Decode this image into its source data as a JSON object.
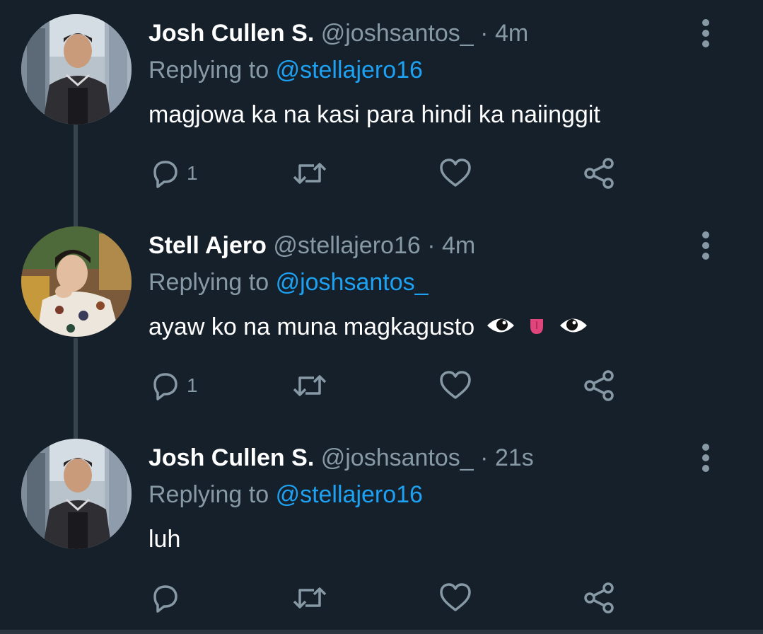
{
  "tweets": [
    {
      "name": "Josh Cullen S.",
      "handle": "@joshsantos_",
      "separator": "·",
      "time": "4m",
      "reply_prefix": "Replying to",
      "reply_to": "@stellajero16",
      "text": "magjowa ka na kasi para hindi ka naiinggit",
      "reply_count": "1",
      "avatar": "josh-avatar"
    },
    {
      "name": "Stell Ajero",
      "handle": "@stellajero16",
      "separator": "·",
      "time": "4m",
      "reply_prefix": "Replying to",
      "reply_to": "@joshsantos_",
      "text": "ayaw ko na muna magkagusto",
      "emojis": [
        "eye",
        "tongue",
        "eye"
      ],
      "reply_count": "1",
      "avatar": "stell-avatar"
    },
    {
      "name": "Josh Cullen S.",
      "handle": "@joshsantos_",
      "separator": "·",
      "time": "21s",
      "reply_prefix": "Replying to",
      "reply_to": "@stellajero16",
      "text": "luh",
      "reply_count": "",
      "avatar": "josh-avatar"
    }
  ],
  "icons": {
    "reply": "reply-icon",
    "retweet": "retweet-icon",
    "like": "heart-icon",
    "share": "share-icon",
    "more": "more-vertical-icon"
  },
  "colors": {
    "background": "#15202b",
    "text": "#ffffff",
    "muted": "#8899a6",
    "link": "#1da1f2",
    "thread_line": "#38444d"
  }
}
